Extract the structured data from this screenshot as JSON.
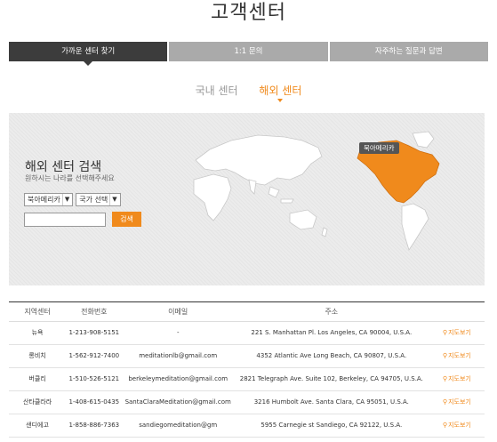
{
  "page": {
    "title": "고객센터"
  },
  "tabs": [
    {
      "label": "가까운 센터 찾기",
      "active": true
    },
    {
      "label": "1:1 문의",
      "active": false
    },
    {
      "label": "자주하는 질문과 답변",
      "active": false
    }
  ],
  "subtabs": [
    {
      "label": "국내 센터",
      "active": false
    },
    {
      "label": "해외 센터",
      "active": true
    }
  ],
  "search": {
    "title": "해외 센터 검색",
    "subtitle": "원하시는 나라를 선택해주세요",
    "region_select": "북아메리카",
    "country_select": "국가 선택",
    "input_value": "",
    "button_label": "검색"
  },
  "map": {
    "highlight_label": "북아메리카",
    "highlight_color": "#f08a1c"
  },
  "table": {
    "headers": [
      "지역센터",
      "전화번호",
      "이메일",
      "주소",
      ""
    ],
    "map_link_label": "지도보기",
    "rows": [
      {
        "center": "뉴욕",
        "phone": "1-213-908-5151",
        "email": "-",
        "address": "221 S. Manhattan Pl. Los Angeles, CA 90004, U.S.A."
      },
      {
        "center": "롱비치",
        "phone": "1-562-912-7400",
        "email": "meditationlb@gmail.com",
        "address": "4352 Atlantic Ave Long Beach, CA 90807, U.S.A."
      },
      {
        "center": "버클리",
        "phone": "1-510-526-5121",
        "email": "berkeleymeditation@gmail.com",
        "address": "2821 Telegraph Ave. Suite 102, Berkeley, CA 94705, U.S.A."
      },
      {
        "center": "산타클라라",
        "phone": "1-408-615-0435",
        "email": "SantaClaraMeditation@gmail.com",
        "address": "3216 Humbolt Ave. Santa Clara, CA 95051, U.S.A."
      },
      {
        "center": "샌디에고",
        "phone": "1-858-886-7363",
        "email": "sandiegomeditation@gm",
        "address": "5955 Carnegie st Sandiego, CA 92122, U.S.A."
      }
    ]
  }
}
